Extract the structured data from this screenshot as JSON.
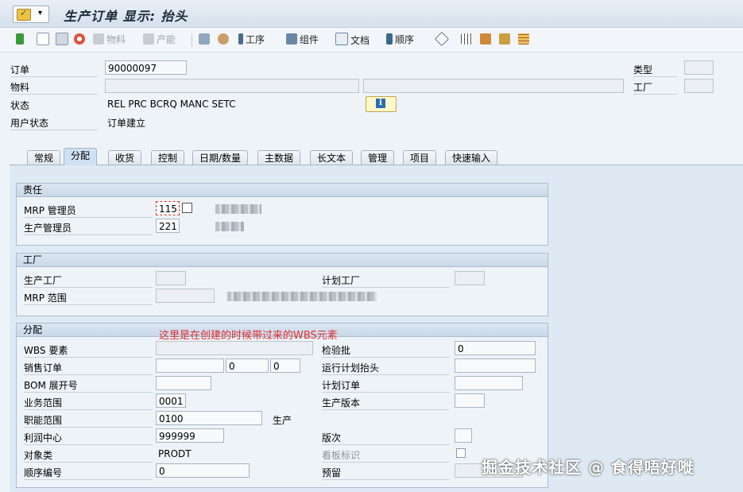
{
  "window": {
    "title": "生产订单 显示: 抬头"
  },
  "toolbar": {
    "items": [
      {
        "label": "",
        "icon": "flag-icon"
      },
      {
        "label": "",
        "icon": "document-icon"
      },
      {
        "label": "",
        "icon": "list-icon"
      },
      {
        "label": "",
        "icon": "lifebuoy-icon"
      },
      {
        "label": "物料",
        "icon": "material-icon",
        "disabled": true
      },
      {
        "label": "产能",
        "icon": "capacity-icon",
        "disabled": true
      },
      {
        "label": "",
        "icon": "hierarchy-icon"
      },
      {
        "label": "",
        "icon": "stack-icon"
      },
      {
        "label": "工序",
        "icon": "operation-icon"
      },
      {
        "label": "组件",
        "icon": "component-icon"
      },
      {
        "label": "文档",
        "icon": "documents-icon"
      },
      {
        "label": "顺序",
        "icon": "sequence-icon"
      },
      {
        "label": "",
        "icon": "cube-icon"
      },
      {
        "label": "",
        "icon": "table-icon"
      },
      {
        "label": "",
        "icon": "tree-icon"
      },
      {
        "label": "",
        "icon": "split-icon"
      },
      {
        "label": "",
        "icon": "grid-icon"
      }
    ]
  },
  "header": {
    "order_label": "订单",
    "order_value": "90000097",
    "material_label": "物料",
    "status_label": "状态",
    "status_value": "REL  PRC  BCRQ MANC SETC",
    "user_status_label": "用户状态",
    "user_status_value": "订单建立",
    "type_label": "类型",
    "plant_label": "工厂"
  },
  "tabs": [
    {
      "label": "常规",
      "active": false
    },
    {
      "label": "分配",
      "active": true
    },
    {
      "label": "收货",
      "active": false
    },
    {
      "label": "控制",
      "active": false
    },
    {
      "label": "日期/数量",
      "active": false
    },
    {
      "label": "主数据",
      "active": false
    },
    {
      "label": "长文本",
      "active": false
    },
    {
      "label": "管理",
      "active": false
    },
    {
      "label": "项目",
      "active": false
    },
    {
      "label": "快速输入",
      "active": false
    }
  ],
  "responsibility": {
    "title": "责任",
    "mrp_controller_label": "MRP 管理员",
    "mrp_controller_value": "115",
    "prod_supervisor_label": "生产管理员",
    "prod_supervisor_value": "221"
  },
  "plant_group": {
    "title": "工厂",
    "prod_plant_label": "生产工厂",
    "planning_plant_label": "计划工厂",
    "mrp_area_label": "MRP 范围"
  },
  "assignment": {
    "title": "分配",
    "wbs_label": "WBS 要素",
    "sales_order_label": "销售订单",
    "sales_order_item": "0",
    "sales_order_sched": "0",
    "bom_explosion_label": "BOM 展开号",
    "business_area_label": "业务范围",
    "business_area_value": "0001",
    "functional_area_label": "职能范围",
    "functional_area_value": "0100",
    "functional_area_text": "生产",
    "profit_center_label": "利润中心",
    "profit_center_value": "999999",
    "object_class_label": "对象类",
    "object_class_value": "PRODT",
    "sequence_no_label": "顺序编号",
    "sequence_no_value": "0",
    "inspection_lot_label": "检验批",
    "inspection_lot_value": "0",
    "run_schedule_label": "运行计划抬头",
    "planned_order_label": "计划订单",
    "prod_version_label": "生产版本",
    "batch_label": "版次",
    "kanban_label": "看板标识",
    "reservation_label": "预留"
  },
  "annotation": "这里是在创建的时候带过来的WBS元素",
  "watermark": "掘金技术社区 @ 食得唔好嘥",
  "colors": {
    "background": "#eef3f8",
    "content": "#dfe9f4",
    "group_header": "#c9d8e8",
    "annotation": "#e03030",
    "focus": "#d93a2b"
  }
}
